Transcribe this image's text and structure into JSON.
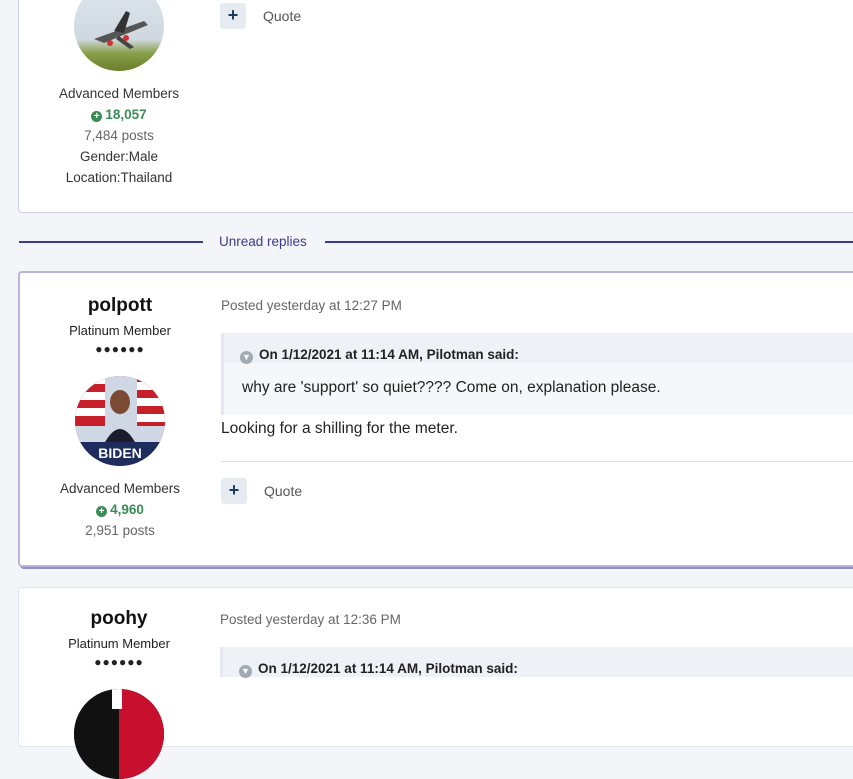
{
  "post1": {
    "member_group": "Advanced Members",
    "reputation": "18,057",
    "posts": "7,484 posts",
    "gender": "Gender:Male",
    "location": "Location:Thailand",
    "add_label": "+",
    "quote_label": "Quote"
  },
  "divider": {
    "label": "Unread replies"
  },
  "post2": {
    "username": "polpott",
    "rank_title": "Platinum Member",
    "rank_pips": "●●●●●●",
    "posted": "Posted yesterday at 12:27 PM",
    "quote_header": "On 1/12/2021 at 11:14 AM, Pilotman said:",
    "quote_text": "why are 'support' so quiet????  Come on, explanation please.",
    "body": "Looking for a shilling for the meter.",
    "member_group": "Advanced Members",
    "reputation": "4,960",
    "posts": "2,951 posts",
    "add_label": "+",
    "quote_label": "Quote",
    "avatar_caption": "BIDEN"
  },
  "post3": {
    "username": "poohy",
    "rank_title": "Platinum Member",
    "rank_pips": "●●●●●●",
    "posted": "Posted yesterday at 12:36 PM",
    "quote_header": "On 1/12/2021 at 11:14 AM, Pilotman said:"
  },
  "icons": {
    "reputation": "plus-circle-icon",
    "quote_toggle": "chevron-down-icon",
    "add": "plus-icon"
  },
  "colors": {
    "accent": "#3c3a8e",
    "reputation": "#3a8c55",
    "unread_border": "#b9b4dc"
  }
}
